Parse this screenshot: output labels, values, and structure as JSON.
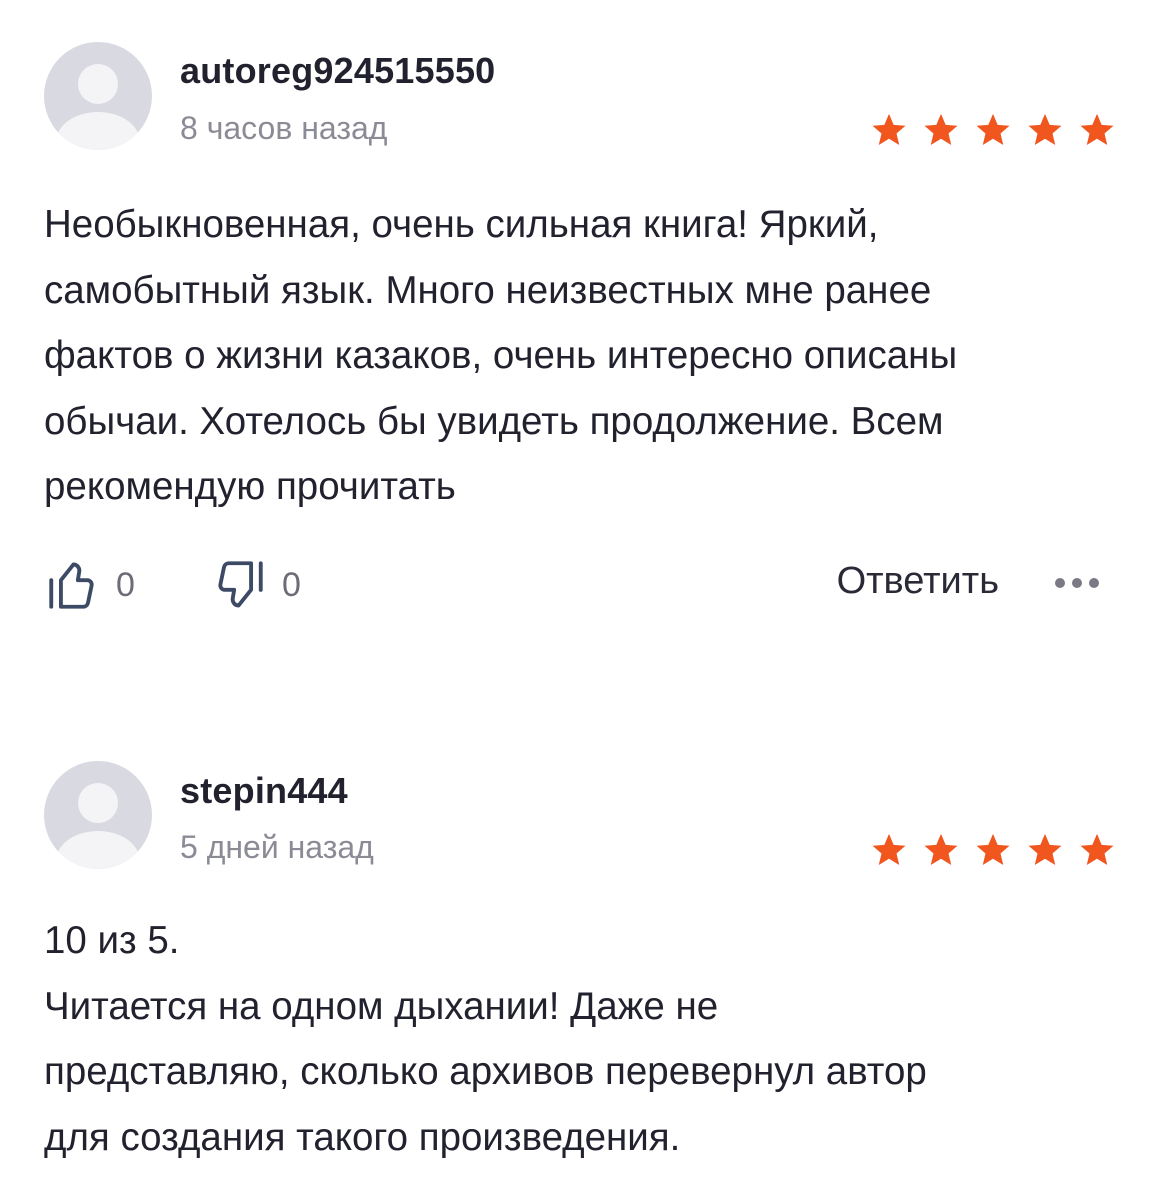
{
  "reviews": [
    {
      "username": "autoreg924515550",
      "time": "8 часов назад",
      "rating": 5,
      "star_color": "#f0561e",
      "body": "Необыкновенная, очень сильная книга! Яркий,\nсамобытный язык. Много неизвестных мне ранее\nфактов о жизни казаков, очень интересно описаны\nобычаи. Хотелось бы увидеть продолжение. Всем\nрекомендую прочитать",
      "likes": "0",
      "dislikes": "0",
      "reply_label": "Ответить",
      "like_icon": "thumbs-up-icon",
      "dislike_icon": "thumbs-down-icon",
      "more_icon": "more-dots-icon"
    },
    {
      "username": "stepin444",
      "time": "5 дней назад",
      "rating": 5,
      "star_color": "#f0561e",
      "body": "10 из 5.\nЧитается на одном дыхании! Даже не\nпредставляю, сколько архивов перевернул автор\nдля создания такого произведения."
    }
  ]
}
